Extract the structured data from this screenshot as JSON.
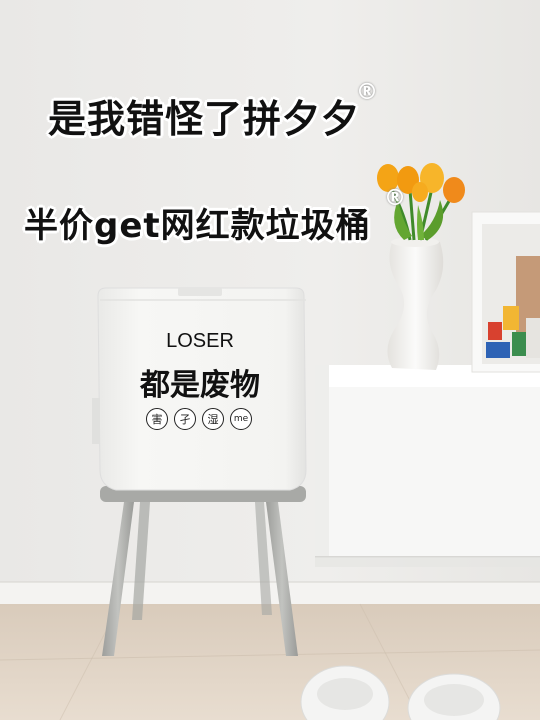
{
  "headline": {
    "line1": "是我错怪了拼夕夕",
    "line2": "半价get网红款垃圾桶",
    "registered_mark": "®"
  },
  "bin_label": {
    "title": "LOSER",
    "subtitle": "都是废物",
    "circles": [
      "害",
      "孑",
      "湿",
      "me"
    ]
  },
  "colors": {
    "wall": "#ecebe9",
    "floor": "#e2d6c8",
    "bin_body": "#f4f4f2",
    "bin_base": "#a8a9a6",
    "tulip": "#f4a416",
    "cabinet": "#f7f7f6"
  }
}
